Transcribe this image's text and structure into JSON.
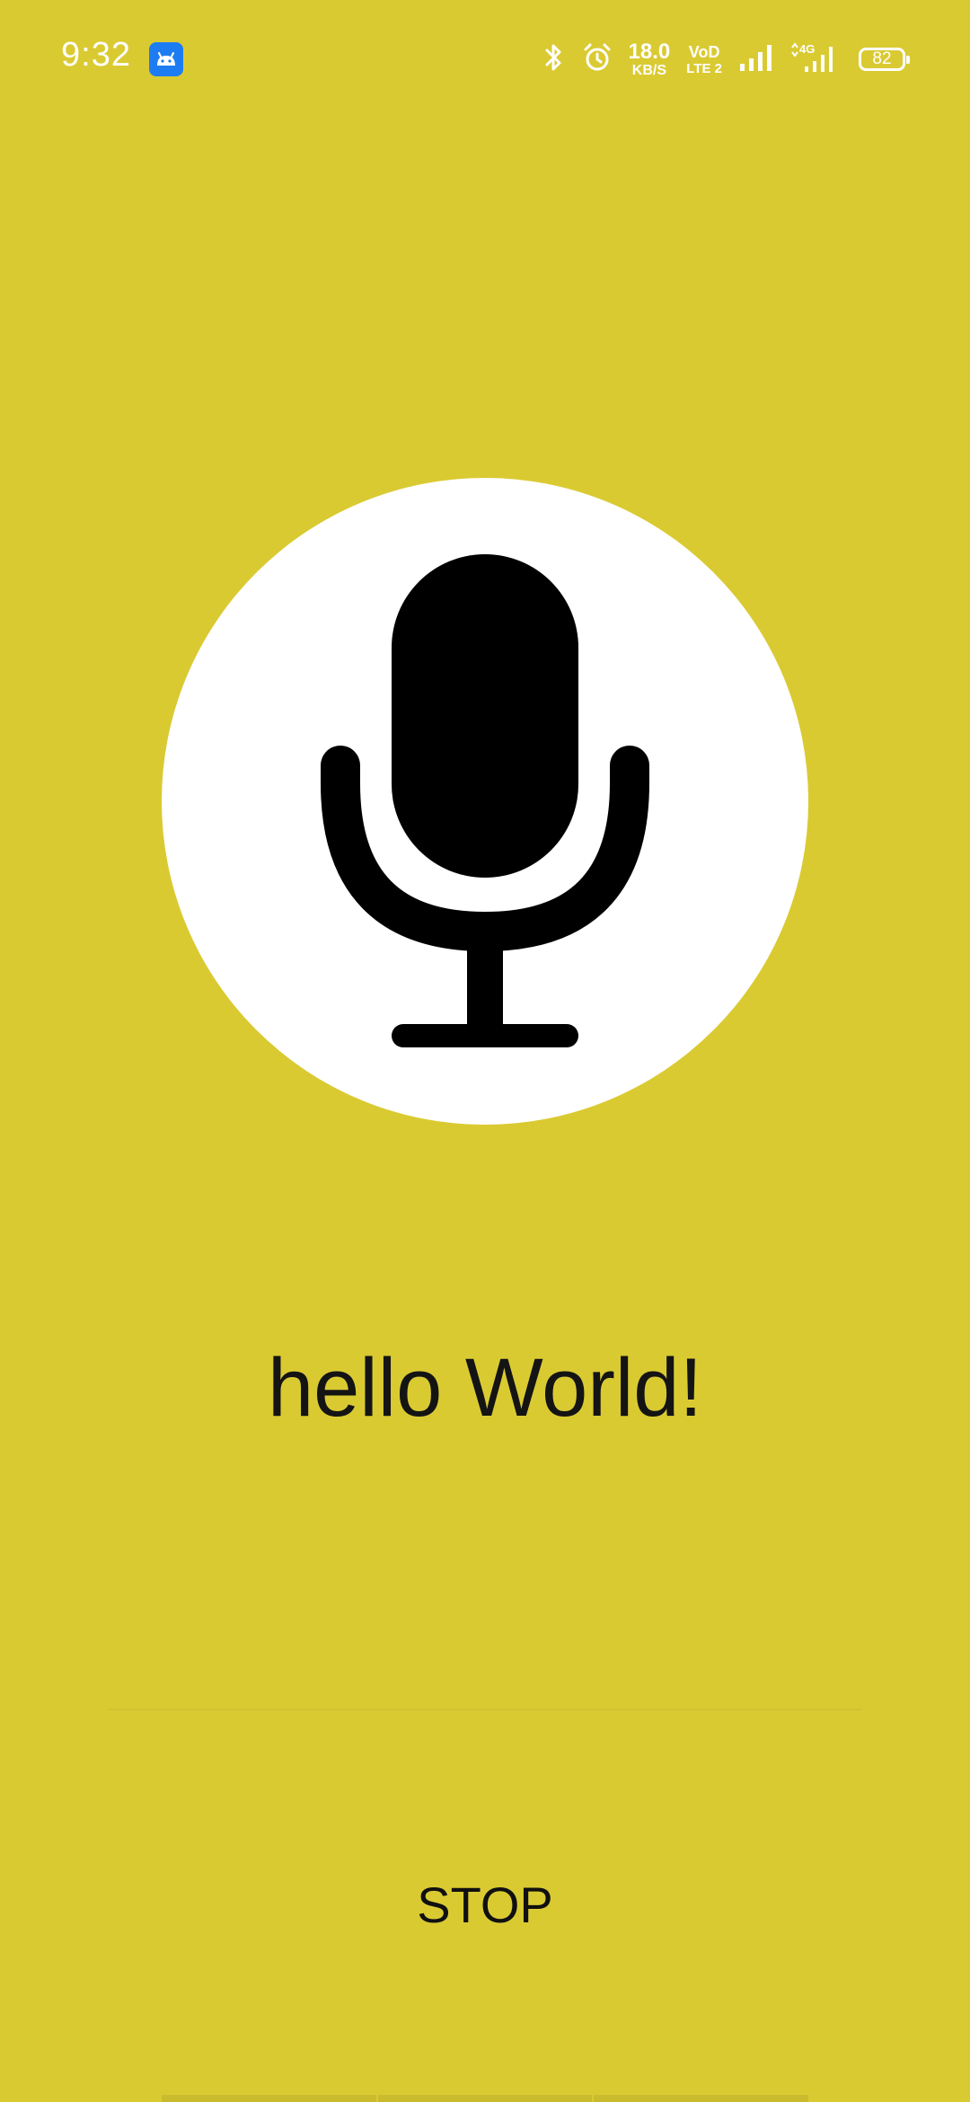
{
  "status_bar": {
    "time": "9:32",
    "net_speed_value": "18.0",
    "net_speed_unit": "KB/S",
    "volte_top": "VoD",
    "volte_bottom": "LTE 2",
    "network_type": "4G",
    "battery_level": "82",
    "icons": [
      "android-app-icon",
      "bluetooth-icon",
      "alarm-icon",
      "signal-icon",
      "signal-4g-icon",
      "battery-icon"
    ]
  },
  "main": {
    "mic_icon": "microphone-icon",
    "result_text": "hello World!",
    "stop_label": "STOP"
  },
  "colors": {
    "background": "#DACA32",
    "mic_circle": "#FFFFFF",
    "mic_glyph": "#000000",
    "text": "#141414"
  }
}
